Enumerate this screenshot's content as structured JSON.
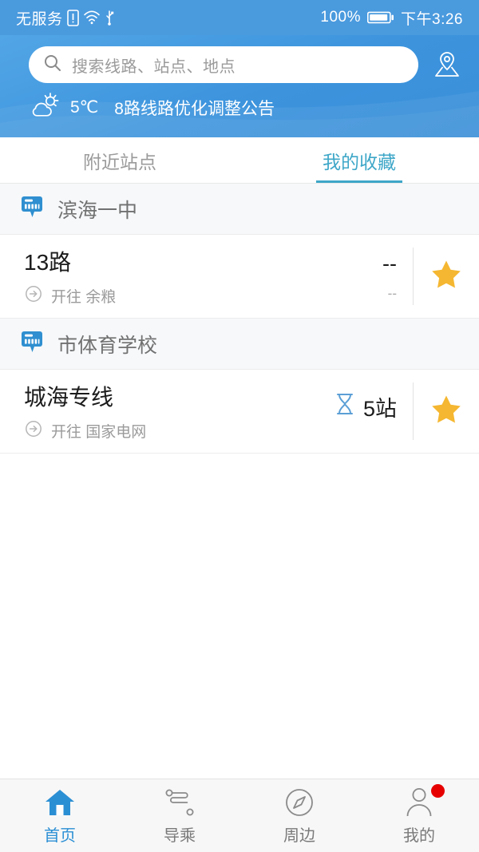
{
  "status_bar": {
    "carrier": "无服务",
    "icons": [
      "sim-alert-icon",
      "wifi-icon",
      "usb-icon"
    ],
    "battery_percent": "100%",
    "time": "下午3:26"
  },
  "header": {
    "search": {
      "placeholder": "搜索线路、站点、地点",
      "icon": "search-icon"
    },
    "map_icon": "map-pin-icon",
    "weather": {
      "icon": "partly-cloudy-icon",
      "temperature": "5℃"
    },
    "notice": "8路线路优化调整公告",
    "background_color": "#3d94dd"
  },
  "tabs": [
    {
      "label": "附近站点",
      "active": false
    },
    {
      "label": "我的收藏",
      "active": true
    }
  ],
  "accent_color": "#3ea7c8",
  "star_color": "#f5b731",
  "stations": [
    {
      "name": "滨海一中",
      "icon": "bus-stop-icon",
      "routes": [
        {
          "name": "13路",
          "direction_icon": "arrow-circle-icon",
          "direction": "开往 余粮",
          "eta_icon": null,
          "eta": "--",
          "eta_sub": "--",
          "favorite_icon": "star-icon",
          "favorited": true
        }
      ]
    },
    {
      "name": "市体育学校",
      "icon": "bus-stop-icon",
      "routes": [
        {
          "name": "城海专线",
          "direction_icon": "arrow-circle-icon",
          "direction": "开往 国家电网",
          "eta_icon": "hourglass-icon",
          "eta": "5站",
          "eta_sub": "",
          "favorite_icon": "star-icon",
          "favorited": true
        }
      ]
    }
  ],
  "bottom_nav": [
    {
      "label": "首页",
      "icon": "home-icon",
      "active": true,
      "badge": false
    },
    {
      "label": "导乘",
      "icon": "route-icon",
      "active": false,
      "badge": false
    },
    {
      "label": "周边",
      "icon": "compass-icon",
      "active": false,
      "badge": false
    },
    {
      "label": "我的",
      "icon": "person-icon",
      "active": false,
      "badge": true
    }
  ]
}
